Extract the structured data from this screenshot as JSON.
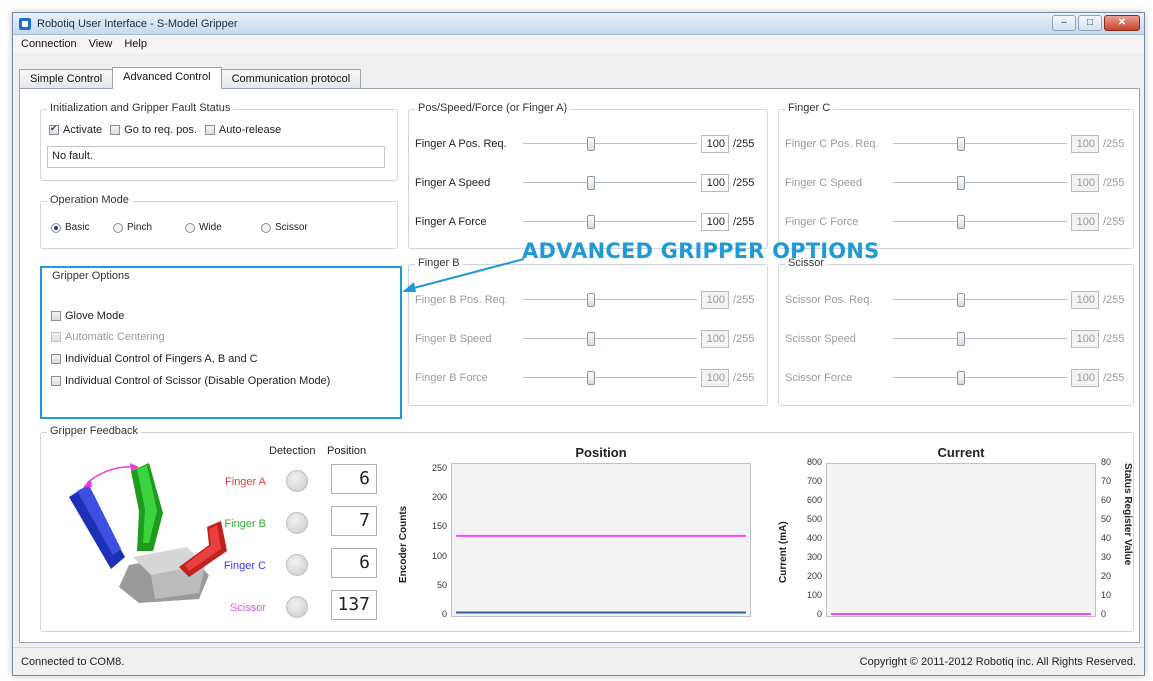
{
  "window": {
    "title": "Robotiq User Interface - S-Model Gripper",
    "controls": {
      "minimize": "–",
      "maximize": "□",
      "close": "✕"
    }
  },
  "menu": [
    "Connection",
    "View",
    "Help"
  ],
  "tabs": [
    {
      "label": "Simple Control",
      "active": false
    },
    {
      "label": "Advanced Control",
      "active": true
    },
    {
      "label": "Communication protocol",
      "active": false
    }
  ],
  "init": {
    "title": "Initialization and Gripper Fault Status",
    "activate": "Activate",
    "activate_checked": true,
    "go_to_req": "Go to req. pos.",
    "auto_release": "Auto-release",
    "fault_text": "No fault."
  },
  "operation_mode": {
    "title": "Operation Mode",
    "options": [
      "Basic",
      "Pinch",
      "Wide",
      "Scissor"
    ],
    "selected": "Basic"
  },
  "gripper_options": {
    "title": "Gripper Options",
    "items": [
      {
        "label": "Glove Mode",
        "disabled": false
      },
      {
        "label": "Automatic Centering",
        "disabled": true
      },
      {
        "label": "Individual Control of Fingers A, B and C",
        "disabled": false
      },
      {
        "label": "Individual Control of Scissor (Disable Operation Mode)",
        "disabled": false
      }
    ]
  },
  "callout": "ADVANCED GRIPPER OPTIONS",
  "groups": {
    "finger_a": {
      "title": "Pos/Speed/Force (or Finger A)",
      "rows": [
        {
          "label": "Finger A Pos. Req.",
          "value": "100",
          "max": "/255"
        },
        {
          "label": "Finger A Speed",
          "value": "100",
          "max": "/255"
        },
        {
          "label": "Finger A Force",
          "value": "100",
          "max": "/255"
        }
      ]
    },
    "finger_c": {
      "title": "Finger C",
      "rows": [
        {
          "label": "Finger C Pos. Req.",
          "value": "100",
          "max": "/255"
        },
        {
          "label": "Finger C Speed",
          "value": "100",
          "max": "/255"
        },
        {
          "label": "Finger C Force",
          "value": "100",
          "max": "/255"
        }
      ]
    },
    "finger_b": {
      "title": "Finger B",
      "rows": [
        {
          "label": "Finger B Pos. Req.",
          "value": "100",
          "max": "/255"
        },
        {
          "label": "Finger B Speed",
          "value": "100",
          "max": "/255"
        },
        {
          "label": "Finger B Force",
          "value": "100",
          "max": "/255"
        }
      ]
    },
    "scissor": {
      "title": "Scissor",
      "rows": [
        {
          "label": "Scissor Pos. Req.",
          "value": "100",
          "max": "/255"
        },
        {
          "label": "Scissor Speed",
          "value": "100",
          "max": "/255"
        },
        {
          "label": "Scissor Force",
          "value": "100",
          "max": "/255"
        }
      ]
    }
  },
  "feedback": {
    "title": "Gripper Feedback",
    "col_detection": "Detection",
    "col_position": "Position",
    "rows": [
      {
        "label": "Finger A",
        "color": "#e23b3b",
        "position": "6"
      },
      {
        "label": "Finger B",
        "color": "#2fae2f",
        "position": "7"
      },
      {
        "label": "Finger C",
        "color": "#3a3ae0",
        "position": "6"
      },
      {
        "label": "Scissor",
        "color": "#e25ae2",
        "position": "137"
      }
    ]
  },
  "chart_data": [
    {
      "type": "line",
      "title": "Position",
      "ylabel": "Encoder Counts",
      "ylim": [
        0,
        260
      ],
      "yticks": [
        "250",
        "200",
        "150",
        "100",
        "50",
        "0"
      ],
      "series": [
        {
          "color": "#ff44ff",
          "values": [
            137,
            137
          ]
        },
        {
          "color": "#2b5fa8",
          "values": [
            6,
            6
          ]
        }
      ]
    },
    {
      "type": "line",
      "title": "Current",
      "ylabel": "Current (mA)",
      "y2label": "Status Register Value",
      "ylim": [
        0,
        800
      ],
      "y2lim": [
        0,
        80
      ],
      "yticks": [
        "800",
        "700",
        "600",
        "500",
        "400",
        "300",
        "200",
        "100",
        "0"
      ],
      "y2ticks": [
        "80",
        "70",
        "60",
        "50",
        "40",
        "30",
        "20",
        "10",
        "0"
      ],
      "series": [
        {
          "color": "#ff44ff",
          "values": [
            0,
            0
          ]
        }
      ]
    }
  ],
  "status": {
    "left": "Connected to COM8.",
    "right": "Copyright © 2011-2012 Robotiq inc. All Rights Reserved."
  }
}
